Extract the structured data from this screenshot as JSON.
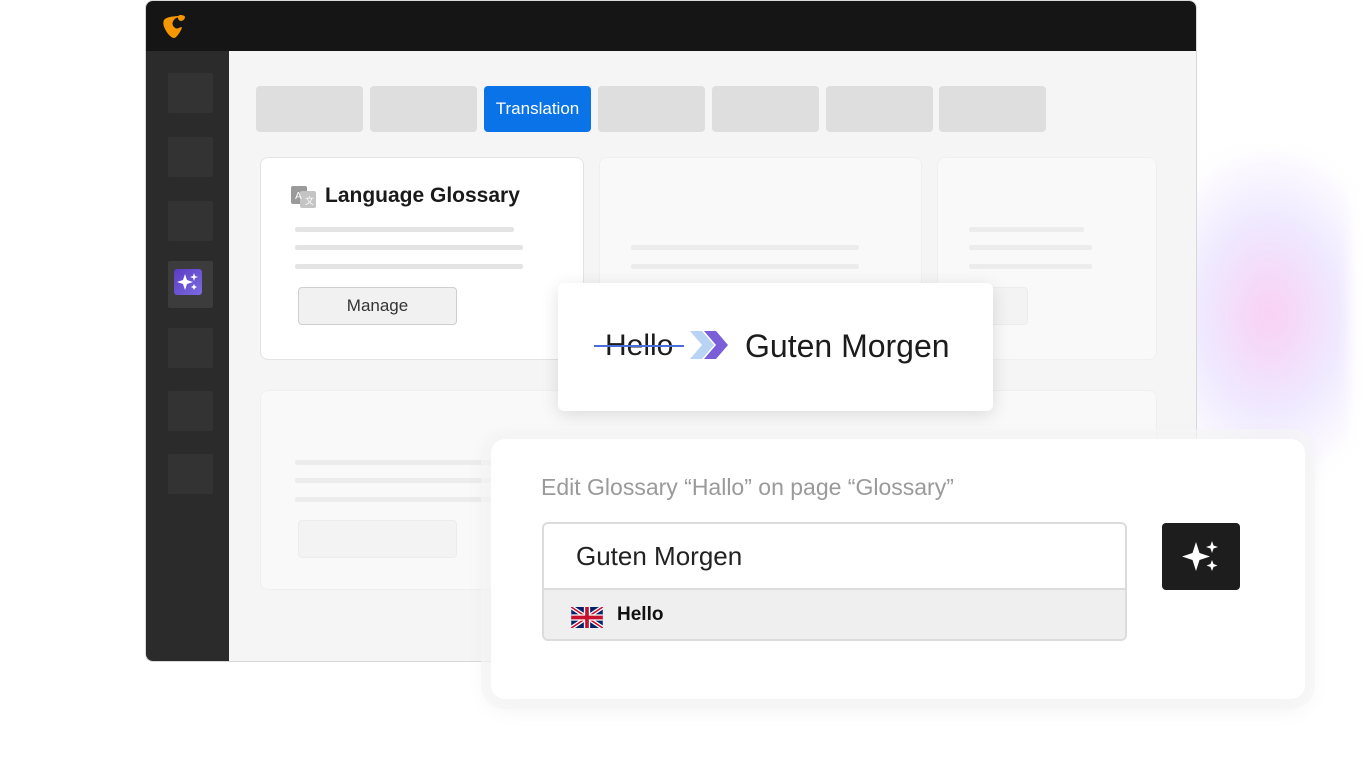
{
  "tabs": [
    {
      "label": ""
    },
    {
      "label": ""
    },
    {
      "label": "Translation",
      "active": true
    },
    {
      "label": ""
    },
    {
      "label": ""
    },
    {
      "label": ""
    },
    {
      "label": ""
    }
  ],
  "glossary_card": {
    "title": "Language Glossary",
    "manage_label": "Manage",
    "icon": "translate-icon"
  },
  "translation_preview": {
    "source_word": "Hello",
    "target_word": "Guten Morgen",
    "arrow_icon": "double-chevron-right-icon"
  },
  "edit_panel": {
    "title": "Edit Glossary “Hallo” on page “Glossary”",
    "input_value": "Guten Morgen",
    "source_language_flag": "uk-flag-icon",
    "source_value": "Hello",
    "ai_button_icon": "sparkles-icon"
  },
  "colors": {
    "accent": "#0a73e8",
    "topbar": "#151515",
    "sidebar": "#2b2b2b",
    "logo": "#f49700",
    "ai_icon": "#5b3cc4"
  }
}
